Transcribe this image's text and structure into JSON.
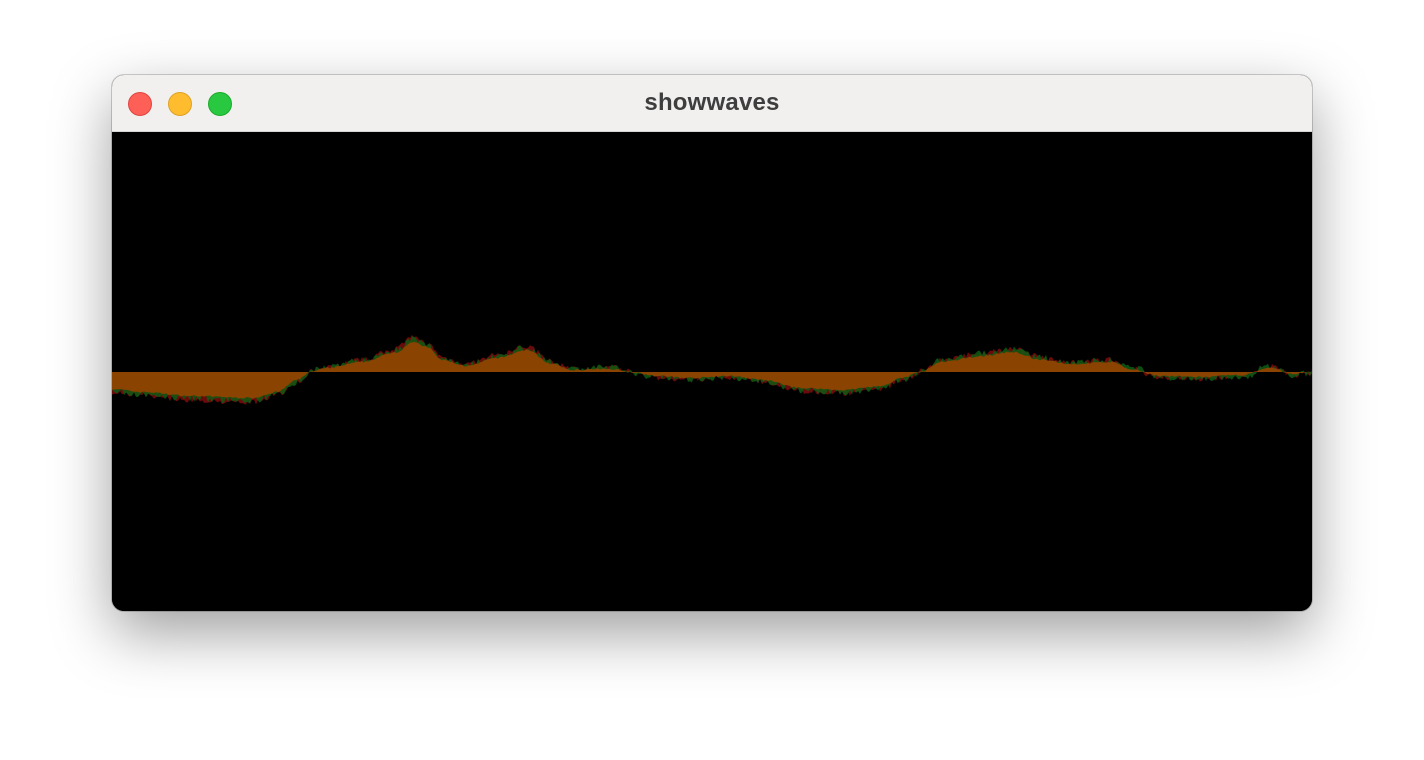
{
  "window": {
    "title": "showwaves"
  },
  "controls": {
    "close_color": "#fe5f57",
    "minimize_color": "#febc2e",
    "zoom_color": "#28c840"
  },
  "waveform": {
    "background_color": "#000000",
    "main_color": "#8a4300",
    "left_channel_color": "#6b0a0a",
    "right_channel_color": "#0e5a14"
  }
}
